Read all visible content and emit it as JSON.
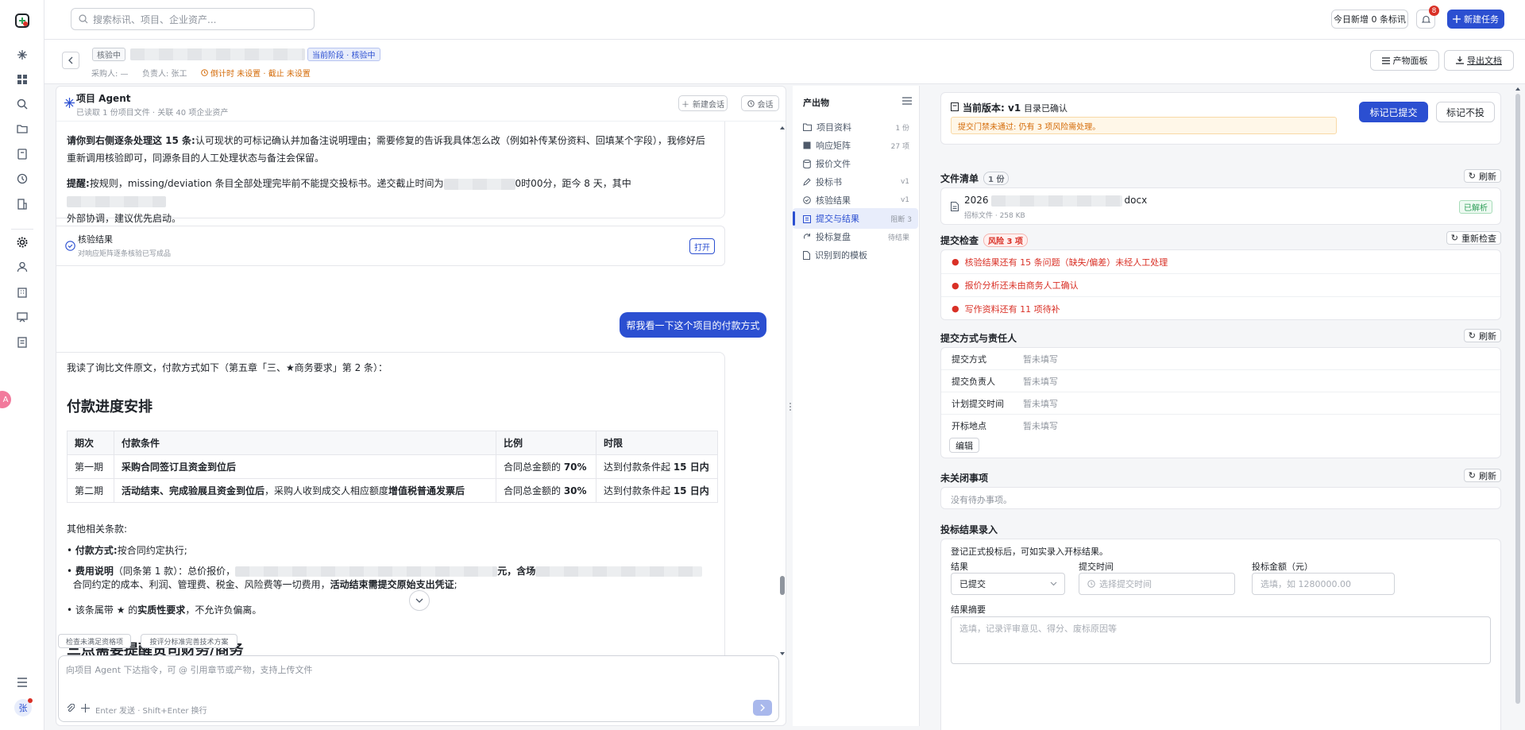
{
  "rail": {
    "user_initial": "张",
    "ai_badge": "A"
  },
  "topbar": {
    "search_placeholder": "搜索标讯、项目、企业资产...",
    "today_btn": "今日新增 0 条标讯",
    "notif_count": "8",
    "new_task": "新建任务"
  },
  "header": {
    "status_tag": "核验中",
    "stage_tag": "当前阶段 · 核验中",
    "buyer": "采购人: —",
    "owner": "负责人: 张工",
    "countdown": "倒计时 未设置 · 截止 未设置",
    "btn_board": "产物面板",
    "btn_export": "导出文档"
  },
  "agent": {
    "title": "项目 Agent",
    "subtitle": "已读取 1 份项目文件 · 关联 40 项企业资产",
    "new_session": "新建会话",
    "sessions": "会话"
  },
  "chat": {
    "p1_bold": "请你到右侧逐条处理这 15 条:",
    "p1": "认可现状的可标记确认并加备注说明理由；需要修复的告诉我具体怎么改（例如补传某份资料、回填某个字段），我修好后重新调用核验即可，同源条目的人工处理状态与备注会保留。",
    "p2_bold": "提醒:",
    "p2_a": "按规则，missing/deviation 条目全部处理完毕前不能提交投标书。递交截止时间为",
    "p2_b": "0时00分，距今 8 天，其中",
    "p2_c": "外部协调，建议优先启动。",
    "verify_card_title": "核验结果",
    "verify_card_sub": "对响应矩阵逐条核验已写成品",
    "verify_card_open": "打开",
    "user_msg": "帮我看一下这个项目的付款方式",
    "intro": "我读了询比文件原文，付款方式如下（第五章「三、★商务要求」第 2 条）：",
    "h_schedule": "付款进度安排",
    "table_headers": [
      "期次",
      "付款条件",
      "比例",
      "时限"
    ],
    "table_rows": [
      {
        "period": "第一期",
        "cond_bold": "采购合同签订且资金到位后",
        "cond": "",
        "ratio_pre": "合同总金额的 ",
        "ratio_bold": "70%",
        "limit_pre": "达到付款条件起 ",
        "limit_bold": "15 日内"
      },
      {
        "period": "第二期",
        "cond_bold": "活动结束、完成验展且资金到位后",
        "cond": "，采购人收到成交人相应额度",
        "cond_bold2": "增值税普通发票后",
        "ratio_pre": "合同总金额的 ",
        "ratio_bold": "30%",
        "limit_pre": "达到付款条件起 ",
        "limit_bold": "15 日内"
      }
    ],
    "other_terms": "其他相关条款:",
    "b1_bold": "付款方式:",
    "b1": "按合同约定执行;",
    "b2_bold": "费用说明",
    "b2": "（同条第 1 款）：总价报价，",
    "b2_yuan": "元，含场",
    "b2_line2": "合同约定的成本、利润、管理费、税金、风险费等一切费用，",
    "b2_line2_bold": "活动结束需提交原始支出凭证",
    "b2_colon": ";",
    "b3_pre": "该条属带 ★ 的",
    "b3_bold": "实质性要求",
    "b3": "，不允许负偏离。",
    "h_three": "三点需要提醒贵司财务/商务"
  },
  "composer": {
    "chip1": "检查未满足资格项",
    "chip2": "按评分标准完善技术方案",
    "placeholder": "向项目 Agent 下达指令，可 @ 引用章节或产物，支持上传文件",
    "hint": "Enter 发送 · Shift+Enter 换行"
  },
  "artifacts": {
    "title": "产出物",
    "items": [
      {
        "label": "项目资料",
        "count": "1 份"
      },
      {
        "label": "响应矩阵",
        "count": "27 项"
      },
      {
        "label": "报价文件",
        "count": ""
      },
      {
        "label": "投标书",
        "count": "v1"
      },
      {
        "label": "核验结果",
        "count": "v1"
      },
      {
        "label": "提交与结果",
        "count": "阻断 3"
      },
      {
        "label": "投标复盘",
        "count": "待结果"
      },
      {
        "label": "识别到的模板",
        "count": ""
      }
    ]
  },
  "right": {
    "version_label": "当前版本:",
    "version": "v1",
    "version_status": "目录已确认",
    "warn": "提交门禁未通过: 仍有 3 项风险需处理。",
    "btn_mark_submitted": "标记已提交",
    "btn_mark_not_bid": "标记不投",
    "files_title": "文件清单",
    "files_count": "1 份",
    "refresh": "刷新",
    "file_name_pre": "2026",
    "file_name_post": "docx",
    "file_meta": "招标文件 · 258 KB",
    "file_status": "已解析",
    "check_title": "提交检查",
    "check_risk": "风险 3 项",
    "recheck": "重新检查",
    "checks": [
      "核验结果还有 15 条问题（缺失/偏差）未经人工处理",
      "报价分析还未由商务人工确认",
      "写作资料还有 11 项待补"
    ],
    "method_title": "提交方式与责任人",
    "method_rows": [
      {
        "k": "提交方式",
        "v": "暂未填写"
      },
      {
        "k": "提交负责人",
        "v": "暂未填写"
      },
      {
        "k": "计划提交时间",
        "v": "暂未填写"
      },
      {
        "k": "开标地点",
        "v": "暂未填写"
      }
    ],
    "edit": "编辑",
    "open_title": "未关闭事项",
    "open_empty": "没有待办事项。",
    "result_title": "投标结果录入",
    "result_hint": "登记正式投标后，可如实录入开标结果。",
    "result_label": "结果",
    "result_value": "已提交",
    "time_label": "提交时间",
    "time_placeholder": "选择提交时间",
    "amount_label": "投标金额（元）",
    "amount_placeholder": "选填，如 1280000.00",
    "summary_label": "结果摘要",
    "summary_placeholder": "选填，记录评审意见、得分、废标原因等"
  },
  "colors": {
    "accent": "#2b4fd1",
    "danger": "#d93026",
    "success": "#2e9e58",
    "warn_bg": "#fff7e8",
    "warn_text": "#d46b08"
  }
}
